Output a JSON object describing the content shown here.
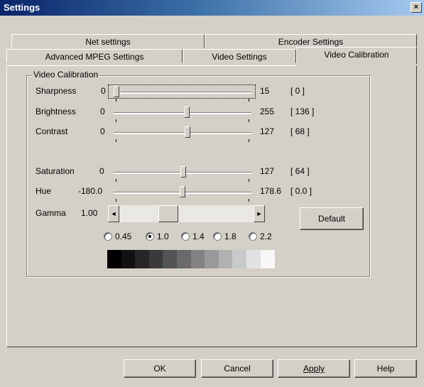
{
  "window": {
    "title": "Settings",
    "close_glyph": "×"
  },
  "tabs": {
    "back_row": [
      "Net settings",
      "Encoder Settings"
    ],
    "front_row": [
      "Advanced MPEG Settings",
      "Video Settings",
      "Video Calibration"
    ],
    "active": "Video Calibration"
  },
  "group": {
    "label": "Video Calibration"
  },
  "sliders": [
    {
      "label": "Sharpness",
      "min": "0",
      "max": "15",
      "current": "[ 0 ]",
      "value": 0
    },
    {
      "label": "Brightness",
      "min": "0",
      "max": "255",
      "current": "[ 136 ]",
      "value": 136
    },
    {
      "label": "Contrast",
      "min": "0",
      "max": "127",
      "current": "[ 68 ]",
      "value": 68
    },
    {
      "label": "Saturation",
      "min": "0",
      "max": "127",
      "current": "[ 64 ]",
      "value": 64
    },
    {
      "label": "Hue",
      "min": "-180.0",
      "max": "178.6",
      "current": "[ 0.0 ]",
      "value": 0.0
    }
  ],
  "gamma": {
    "label": "Gamma",
    "value": "1.00",
    "left_arrow": "◄",
    "right_arrow": "►",
    "default_button": "Default",
    "options": [
      "0.45",
      "1.0",
      "1.4",
      "1.8",
      "2.2"
    ],
    "selected": "1.0",
    "swatches": [
      "#000000",
      "#111111",
      "#262626",
      "#3a3a3a",
      "#535353",
      "#6a6a6a",
      "#828282",
      "#999999",
      "#b1b1b1",
      "#c9c9c9",
      "#e2e2e2",
      "#f7f7f7"
    ]
  },
  "buttons": {
    "ok": "OK",
    "cancel": "Cancel",
    "apply": "Apply",
    "help": "Help"
  }
}
